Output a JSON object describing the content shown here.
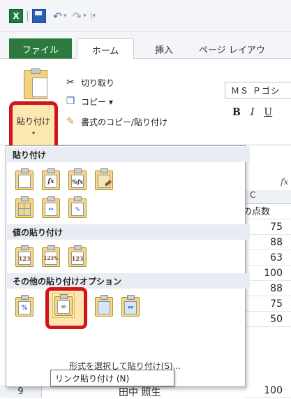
{
  "app": {
    "logo_letter": "X"
  },
  "qat": {
    "separator": "|",
    "undo": "↶",
    "redo": "↷",
    "dropdown": "▾",
    "customize": "|▾"
  },
  "tabs": {
    "file": "ファイル",
    "home": "ホーム",
    "insert": "挿入",
    "page_layout": "ページ レイアウ"
  },
  "ribbon": {
    "paste_label": "貼り付け",
    "paste_arrow": "▾",
    "cut": "切り取り",
    "copy": "コピー ▾",
    "format_painter": "書式のコピー/貼り付け",
    "font_name": "ＭＳ Ｐゴシ",
    "bold": "B",
    "italic": "I",
    "underline": "U"
  },
  "menu": {
    "section_paste": "貼り付け",
    "section_values": "値の貼り付け",
    "section_other": "その他の貼り付けオプション",
    "paste_special": "形式を選択して貼り付け(S)...",
    "icons_row1": [
      "",
      "fx",
      "%fx",
      ""
    ],
    "icons_row3": [
      "123",
      "123%",
      "123"
    ],
    "tooltip": "リンク貼り付け (N)"
  },
  "sheet": {
    "fx": "fx",
    "col_letter": "C",
    "col_header": "の点数",
    "values": [
      "75",
      "88",
      "63",
      "100",
      "88",
      "75",
      "50",
      "100"
    ],
    "row_number": "9",
    "name_cell": "田中 照生"
  },
  "colors": {
    "accent_red": "#d2141c",
    "file_tab": "#2d7a3f",
    "highlight": "#fde7b0"
  }
}
